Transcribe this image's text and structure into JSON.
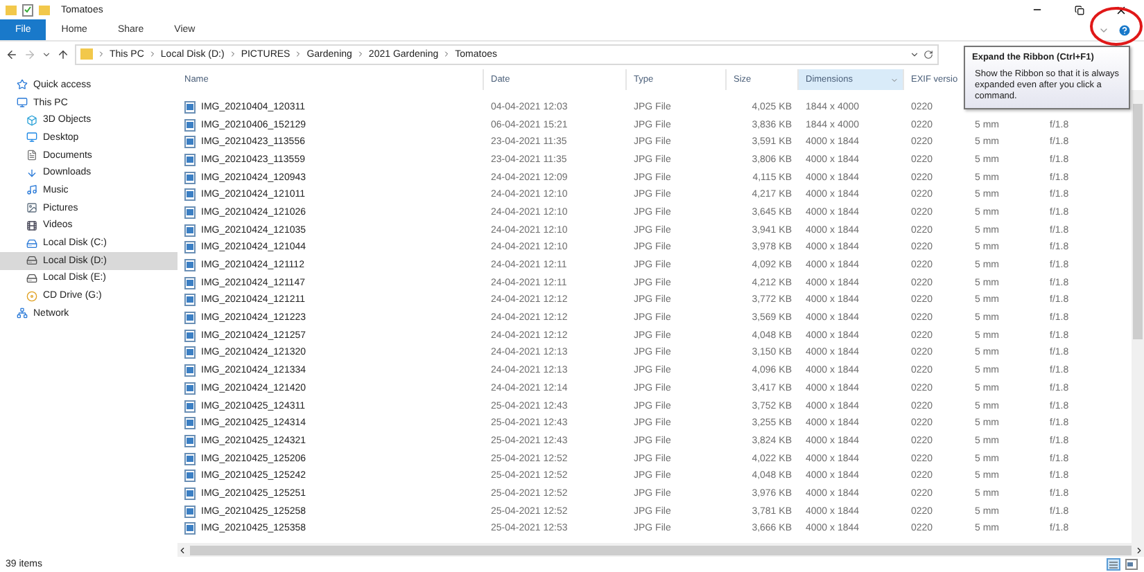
{
  "window": {
    "title": "Tomatoes"
  },
  "ribbon_tabs": [
    {
      "label": "File",
      "selected": true
    },
    {
      "label": "Home",
      "selected": false
    },
    {
      "label": "Share",
      "selected": false
    },
    {
      "label": "View",
      "selected": false
    }
  ],
  "address": {
    "segments": [
      "This PC",
      "Local Disk (D:)",
      "PICTURES",
      "Gardening",
      "2021 Gardening",
      "Tomatoes"
    ]
  },
  "sidebar": {
    "items": [
      {
        "label": "Quick access",
        "selected": false
      },
      {
        "label": "This PC",
        "selected": false,
        "children": [
          {
            "label": "3D Objects",
            "selected": false
          },
          {
            "label": "Desktop",
            "selected": false
          },
          {
            "label": "Documents",
            "selected": false
          },
          {
            "label": "Downloads",
            "selected": false
          },
          {
            "label": "Music",
            "selected": false
          },
          {
            "label": "Pictures",
            "selected": false
          },
          {
            "label": "Videos",
            "selected": false
          },
          {
            "label": "Local Disk (C:)",
            "selected": false
          },
          {
            "label": "Local Disk (D:)",
            "selected": true
          },
          {
            "label": "Local Disk (E:)",
            "selected": false
          },
          {
            "label": "CD Drive (G:)",
            "selected": false
          }
        ]
      },
      {
        "label": "Network",
        "selected": false
      }
    ]
  },
  "table": {
    "columns": [
      {
        "label": "Name",
        "highlighted": false
      },
      {
        "label": "Date",
        "highlighted": false
      },
      {
        "label": "Type",
        "highlighted": false
      },
      {
        "label": "Size",
        "highlighted": false
      },
      {
        "label": "Dimensions",
        "highlighted": true
      },
      {
        "label": "EXIF versio",
        "highlighted": false
      }
    ],
    "rows": [
      [
        "IMG_20210404_120311",
        "04-04-2021 12:03",
        "JPG File",
        "4,025 KB",
        "1844 x 4000",
        "0220"
      ],
      [
        "IMG_20210406_152129",
        "06-04-2021 15:21",
        "JPG File",
        "3,836 KB",
        "1844 x 4000",
        "0220",
        "5 mm",
        "f/1.8"
      ],
      [
        "IMG_20210423_113556",
        "23-04-2021 11:35",
        "JPG File",
        "3,591 KB",
        "4000 x 1844",
        "0220",
        "5 mm",
        "f/1.8"
      ],
      [
        "IMG_20210423_113559",
        "23-04-2021 11:35",
        "JPG File",
        "3,806 KB",
        "4000 x 1844",
        "0220",
        "5 mm",
        "f/1.8"
      ],
      [
        "IMG_20210424_120943",
        "24-04-2021 12:09",
        "JPG File",
        "4,115 KB",
        "4000 x 1844",
        "0220",
        "5 mm",
        "f/1.8"
      ],
      [
        "IMG_20210424_121011",
        "24-04-2021 12:10",
        "JPG File",
        "4,217 KB",
        "4000 x 1844",
        "0220",
        "5 mm",
        "f/1.8"
      ],
      [
        "IMG_20210424_121026",
        "24-04-2021 12:10",
        "JPG File",
        "3,645 KB",
        "4000 x 1844",
        "0220",
        "5 mm",
        "f/1.8"
      ],
      [
        "IMG_20210424_121035",
        "24-04-2021 12:10",
        "JPG File",
        "3,941 KB",
        "4000 x 1844",
        "0220",
        "5 mm",
        "f/1.8"
      ],
      [
        "IMG_20210424_121044",
        "24-04-2021 12:10",
        "JPG File",
        "3,978 KB",
        "4000 x 1844",
        "0220",
        "5 mm",
        "f/1.8"
      ],
      [
        "IMG_20210424_121112",
        "24-04-2021 12:11",
        "JPG File",
        "4,092 KB",
        "4000 x 1844",
        "0220",
        "5 mm",
        "f/1.8"
      ],
      [
        "IMG_20210424_121147",
        "24-04-2021 12:11",
        "JPG File",
        "4,212 KB",
        "4000 x 1844",
        "0220",
        "5 mm",
        "f/1.8"
      ],
      [
        "IMG_20210424_121211",
        "24-04-2021 12:12",
        "JPG File",
        "3,772 KB",
        "4000 x 1844",
        "0220",
        "5 mm",
        "f/1.8"
      ],
      [
        "IMG_20210424_121223",
        "24-04-2021 12:12",
        "JPG File",
        "3,569 KB",
        "4000 x 1844",
        "0220",
        "5 mm",
        "f/1.8"
      ],
      [
        "IMG_20210424_121257",
        "24-04-2021 12:12",
        "JPG File",
        "4,048 KB",
        "4000 x 1844",
        "0220",
        "5 mm",
        "f/1.8"
      ],
      [
        "IMG_20210424_121320",
        "24-04-2021 12:13",
        "JPG File",
        "3,150 KB",
        "4000 x 1844",
        "0220",
        "5 mm",
        "f/1.8"
      ],
      [
        "IMG_20210424_121334",
        "24-04-2021 12:13",
        "JPG File",
        "4,096 KB",
        "4000 x 1844",
        "0220",
        "5 mm",
        "f/1.8"
      ],
      [
        "IMG_20210424_121420",
        "24-04-2021 12:14",
        "JPG File",
        "3,417 KB",
        "4000 x 1844",
        "0220",
        "5 mm",
        "f/1.8"
      ],
      [
        "IMG_20210425_124311",
        "25-04-2021 12:43",
        "JPG File",
        "3,752 KB",
        "4000 x 1844",
        "0220",
        "5 mm",
        "f/1.8"
      ],
      [
        "IMG_20210425_124314",
        "25-04-2021 12:43",
        "JPG File",
        "3,255 KB",
        "4000 x 1844",
        "0220",
        "5 mm",
        "f/1.8"
      ],
      [
        "IMG_20210425_124321",
        "25-04-2021 12:43",
        "JPG File",
        "3,824 KB",
        "4000 x 1844",
        "0220",
        "5 mm",
        "f/1.8"
      ],
      [
        "IMG_20210425_125206",
        "25-04-2021 12:52",
        "JPG File",
        "4,022 KB",
        "4000 x 1844",
        "0220",
        "5 mm",
        "f/1.8"
      ],
      [
        "IMG_20210425_125242",
        "25-04-2021 12:52",
        "JPG File",
        "4,048 KB",
        "4000 x 1844",
        "0220",
        "5 mm",
        "f/1.8"
      ],
      [
        "IMG_20210425_125251",
        "25-04-2021 12:52",
        "JPG File",
        "3,976 KB",
        "4000 x 1844",
        "0220",
        "5 mm",
        "f/1.8"
      ],
      [
        "IMG_20210425_125258",
        "25-04-2021 12:52",
        "JPG File",
        "3,781 KB",
        "4000 x 1844",
        "0220",
        "5 mm",
        "f/1.8"
      ],
      [
        "IMG_20210425_125358",
        "25-04-2021 12:53",
        "JPG File",
        "3,666 KB",
        "4000 x 1844",
        "0220",
        "5 mm",
        "f/1.8"
      ]
    ]
  },
  "tooltip": {
    "title": "Expand the Ribbon (Ctrl+F1)",
    "text": "Show the Ribbon so that it is always expanded even after you click a command."
  },
  "status_bar": {
    "count": "39 items"
  }
}
